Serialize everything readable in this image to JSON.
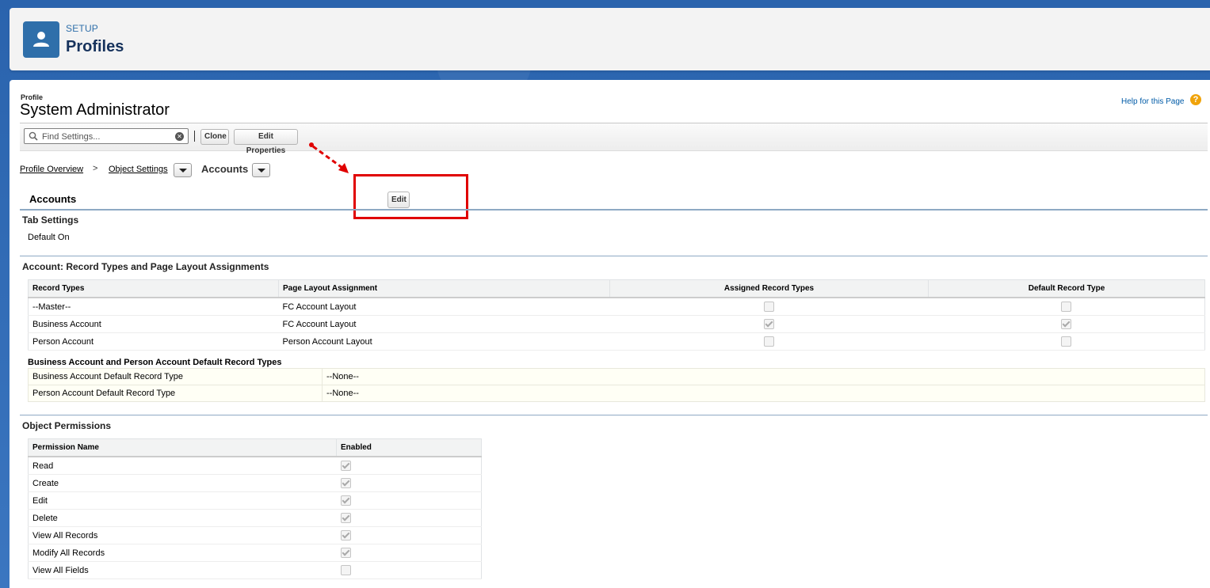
{
  "header": {
    "setup_label": "SETUP",
    "title": "Profiles",
    "icon": "user-icon"
  },
  "profile": {
    "label": "Profile",
    "name": "System Administrator",
    "help_link": "Help for this Page",
    "help_icon": "?"
  },
  "toolbar": {
    "search_placeholder": "Find Settings...",
    "clone_label": "Clone",
    "edit_properties_label": "Edit Properties"
  },
  "breadcrumb": {
    "overview": "Profile Overview",
    "separator": ">",
    "object_settings": "Object Settings",
    "current": "Accounts"
  },
  "accounts": {
    "title": "Accounts",
    "edit_label": "Edit"
  },
  "tab_settings": {
    "title": "Tab Settings",
    "value": "Default On"
  },
  "record_types": {
    "title": "Account: Record Types and Page Layout Assignments",
    "headers": [
      "Record Types",
      "Page Layout Assignment",
      "Assigned Record Types",
      "Default Record Type"
    ],
    "rows": [
      {
        "type": "--Master--",
        "layout": "FC Account Layout",
        "assigned": false,
        "default": false
      },
      {
        "type": "Business Account",
        "layout": "FC Account Layout",
        "assigned": true,
        "default": true
      },
      {
        "type": "Person Account",
        "layout": "Person Account Layout",
        "assigned": false,
        "default": false
      }
    ]
  },
  "defaults": {
    "title": "Business Account and Person Account Default Record Types",
    "rows": [
      {
        "label": "Business Account Default Record Type",
        "value": "--None--"
      },
      {
        "label": "Person Account Default Record Type",
        "value": "--None--"
      }
    ]
  },
  "permissions": {
    "title": "Object Permissions",
    "headers": [
      "Permission Name",
      "Enabled"
    ],
    "rows": [
      {
        "name": "Read",
        "enabled": true
      },
      {
        "name": "Create",
        "enabled": true
      },
      {
        "name": "Edit",
        "enabled": true
      },
      {
        "name": "Delete",
        "enabled": true
      },
      {
        "name": "View All Records",
        "enabled": true
      },
      {
        "name": "Modify All Records",
        "enabled": true
      },
      {
        "name": "View All Fields",
        "enabled": false
      }
    ]
  },
  "colors": {
    "accent": "#2f6faa",
    "annotation": "#e00000"
  }
}
